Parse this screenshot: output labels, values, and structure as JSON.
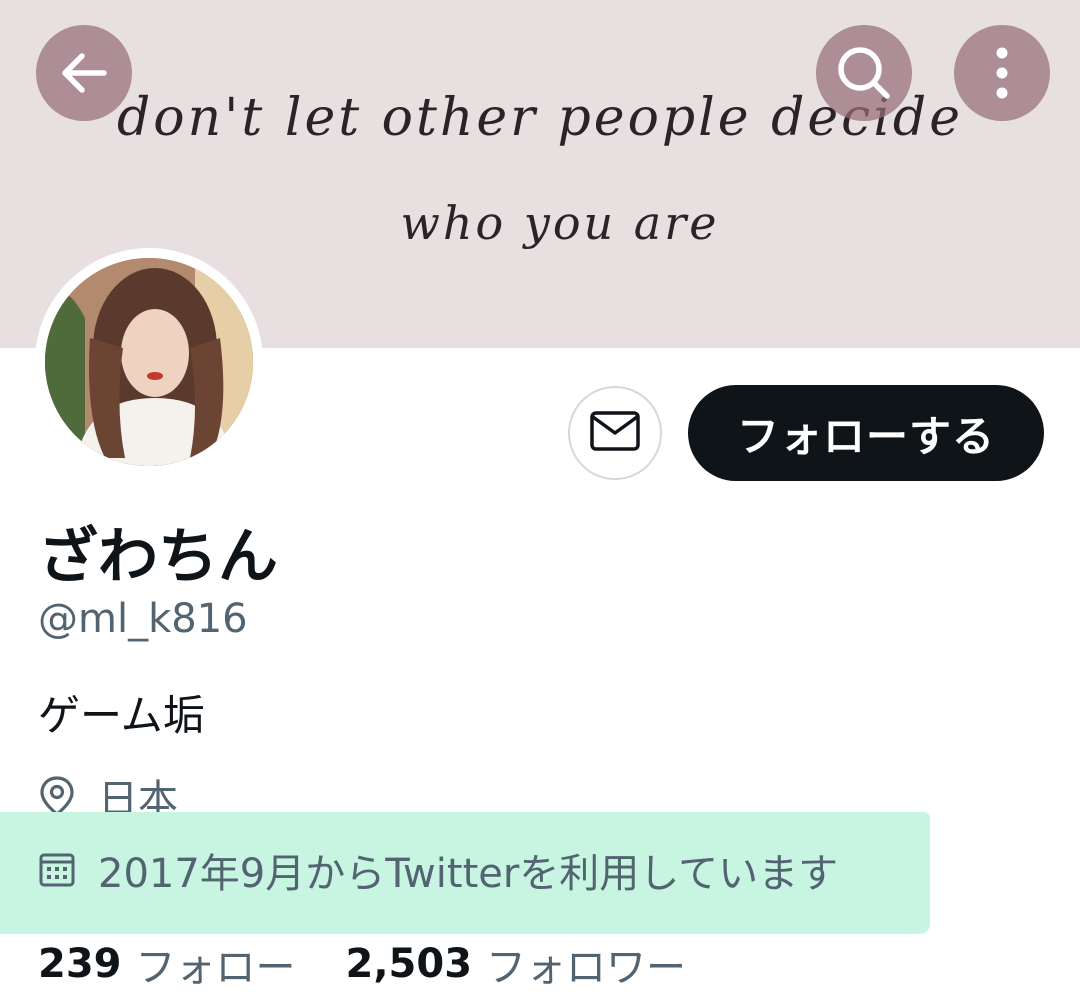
{
  "banner": {
    "line1": "don't let other people decide",
    "line2": "who you are"
  },
  "header": {
    "back_icon": "arrow-left-icon",
    "search_icon": "search-icon",
    "more_icon": "more-vertical-icon"
  },
  "profile": {
    "display_name": "ざわちん",
    "handle": "@ml_k816",
    "bio": "ゲーム垢",
    "location": "日本",
    "joined": "2017年9月からTwitterを利用しています"
  },
  "actions": {
    "message_icon": "mail-icon",
    "follow_label": "フォローする"
  },
  "stats": {
    "following_count": "239",
    "following_label": "フォロー",
    "followers_count": "2,503",
    "followers_label": "フォロワー"
  },
  "colors": {
    "banner_bg": "#e8dfe1",
    "button_dark": "#0f1419",
    "secondary_text": "#536471",
    "highlight": "#c8f5e2"
  }
}
